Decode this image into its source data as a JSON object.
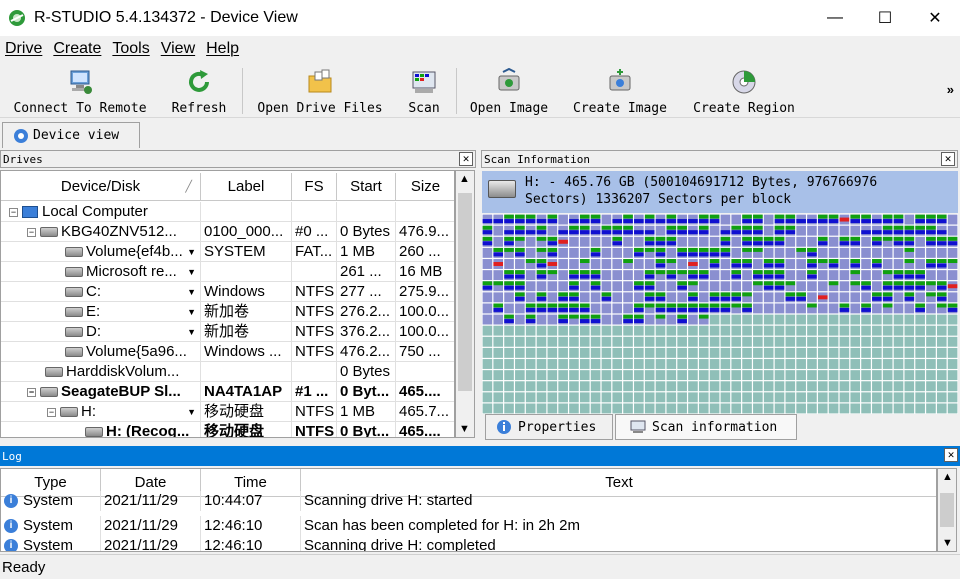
{
  "window": {
    "title": "R-STUDIO 5.4.134372 - Device View",
    "minimize_label": "—",
    "maximize_label": "☐",
    "close_label": "✕"
  },
  "menu": [
    "Drive",
    "Create",
    "Tools",
    "View",
    "Help"
  ],
  "toolbar": {
    "connect_remote": "Connect To Remote",
    "refresh": "Refresh",
    "open_drive_files": "Open Drive Files",
    "scan": "Scan",
    "open_image": "Open Image",
    "create_image": "Create Image",
    "create_region": "Create Region",
    "more": "»"
  },
  "view_tab": "Device view",
  "drives": {
    "title": "Drives",
    "columns": [
      "Device/Disk",
      "Label",
      "FS",
      "Start",
      "Size"
    ],
    "rows": [
      {
        "device": "Local Computer",
        "label": "",
        "fs": "",
        "start": "",
        "size": ""
      },
      {
        "device": "KBG40ZNV512...",
        "label": "0100_000...",
        "fs": "#0 ...",
        "start": "0 Bytes",
        "size": "476.9..."
      },
      {
        "device": "Volume{ef4b...",
        "label": "SYSTEM",
        "fs": "FAT...",
        "start": "1 MB",
        "size": "260 ..."
      },
      {
        "device": "Microsoft re...",
        "label": "",
        "fs": "",
        "start": "261 ...",
        "size": "16 MB"
      },
      {
        "device": "C:",
        "label": "Windows",
        "fs": "NTFS",
        "start": "277 ...",
        "size": "275.9..."
      },
      {
        "device": "E:",
        "label": "新加卷",
        "fs": "NTFS",
        "start": "276.2...",
        "size": "100.0..."
      },
      {
        "device": "D:",
        "label": "新加卷",
        "fs": "NTFS",
        "start": "376.2...",
        "size": "100.0..."
      },
      {
        "device": "Volume{5a96...",
        "label": "Windows ...",
        "fs": "NTFS",
        "start": "476.2...",
        "size": "750 ..."
      },
      {
        "device": "HarddiskVolum...",
        "label": "",
        "fs": "",
        "start": "0 Bytes",
        "size": ""
      },
      {
        "device": "SeagateBUP Sl...",
        "label": "NA4TA1AP",
        "fs": "#1 ...",
        "start": "0 Byt...",
        "size": "465...."
      },
      {
        "device": "H:",
        "label": "移动硬盘",
        "fs": "NTFS",
        "start": "1 MB",
        "size": "465.7..."
      },
      {
        "device": "H: (Recog...",
        "label": "移动硬盘",
        "fs": "NTFS",
        "start": "0 Byt...",
        "size": "465...."
      }
    ]
  },
  "scan": {
    "title": "Scan Information",
    "line1": "H: - 465.76 GB (500104691712 Bytes, 976766976",
    "line2": "Sectors) 1336207 Sectors per block",
    "tab_properties": "Properties",
    "tab_scaninfo": "Scan information"
  },
  "log": {
    "title": "Log",
    "columns": [
      "Type",
      "Date",
      "Time",
      "Text"
    ],
    "rows": [
      {
        "type": "System",
        "date": "2021/11/29",
        "time": "10:44:07",
        "text": "Scanning drive H: started"
      },
      {
        "type": "System",
        "date": "2021/11/29",
        "time": "12:46:10",
        "text": "Scan has been completed for H: in 2h 2m"
      },
      {
        "type": "System",
        "date": "2021/11/29",
        "time": "12:46:10",
        "text": "Scanning drive H: completed"
      }
    ]
  },
  "status": "Ready",
  "colors": {
    "scan_empty": "#8a8fd0",
    "scan_teal": "#8fbfb8",
    "scan_green": "#10a010",
    "scan_blue": "#1010d0",
    "scan_red": "#e02020",
    "scan_yellow": "#f0f000",
    "log_header": "#0078d7",
    "scan_header": "#a8c0e8"
  }
}
